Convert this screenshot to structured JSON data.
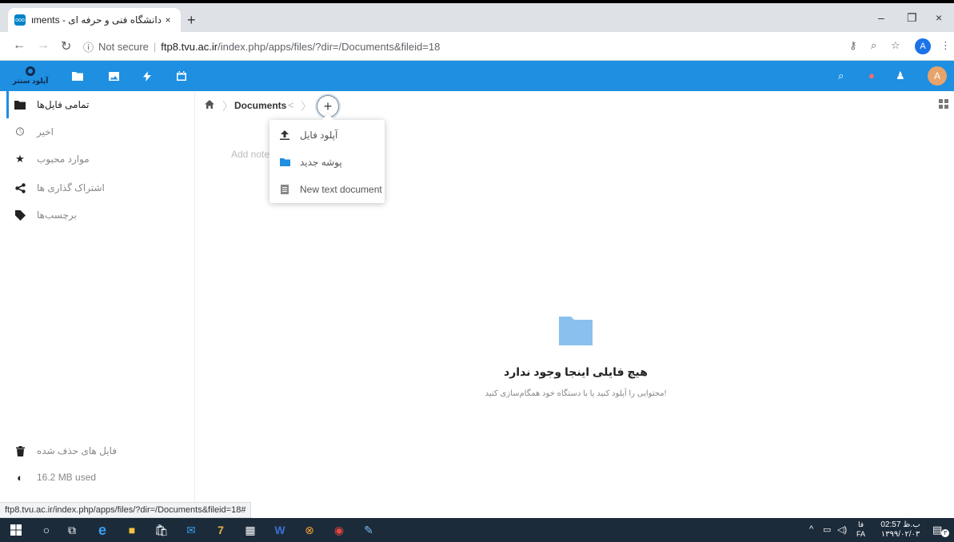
{
  "browser": {
    "tab_title": "دانشگاه فنی و حرفه ای - Documents",
    "favicon_text": "ooo",
    "new_tab": "+",
    "tab_close": "×",
    "window_controls": [
      "–",
      "❐",
      "×"
    ],
    "address": {
      "info": "ⓘ",
      "not_secure": "Not secure",
      "separator": "|",
      "host": "ftp8.tvu.ac.ir",
      "path": "/index.php/apps/files/?dir=/Documents&fileid=18"
    },
    "profile_initial": "A"
  },
  "nc_header": {
    "logo_text": "آپلود سنتر",
    "avatar_initial": "A"
  },
  "sidebar": {
    "items": [
      {
        "label": "تمامی فایل‌ها",
        "icon": "folder-icon",
        "active": true
      },
      {
        "label": "اخیر",
        "icon": "clock-icon"
      },
      {
        "label": "موارد محبوب",
        "icon": "star-icon"
      },
      {
        "label": "اشتراک گذاری ها",
        "icon": "share-icon"
      },
      {
        "label": "برچسب‌ها",
        "icon": "tag-icon"
      }
    ],
    "bottom": [
      {
        "label": "فایل های حذف شده",
        "icon": "trash-icon"
      },
      {
        "label": "16.2 MB used",
        "icon": "quota-icon"
      }
    ]
  },
  "breadcrumb": {
    "current": "Documents",
    "add_label": "+"
  },
  "notes_placeholder": "Add note",
  "new_menu": {
    "items": [
      {
        "label": "آپلود فایل",
        "icon": "upload-icon"
      },
      {
        "label": "پوشه جدید",
        "icon": "folder-icon"
      },
      {
        "label": "New text document",
        "icon": "text-document-icon"
      }
    ]
  },
  "empty_state": {
    "title": "هیچ فایلی اینجا وجود ندارد",
    "subtitle": "!محتوایی را آپلود کنید یا با دستگاه خود همگام‌سازی کنید"
  },
  "status_url": "ftp8.tvu.ac.ir/index.php/apps/files/?dir=/Documents&fileid=18#",
  "taskbar": {
    "language": "FA",
    "lang_top": "فا",
    "time": "02:57 ب.ظ",
    "date": "۱۳۹۹/۰۲/۰۳",
    "notification_count": "۳"
  },
  "colors": {
    "nextcloud_blue": "#1e8fe1",
    "folder_blue": "#8ac0ee"
  }
}
